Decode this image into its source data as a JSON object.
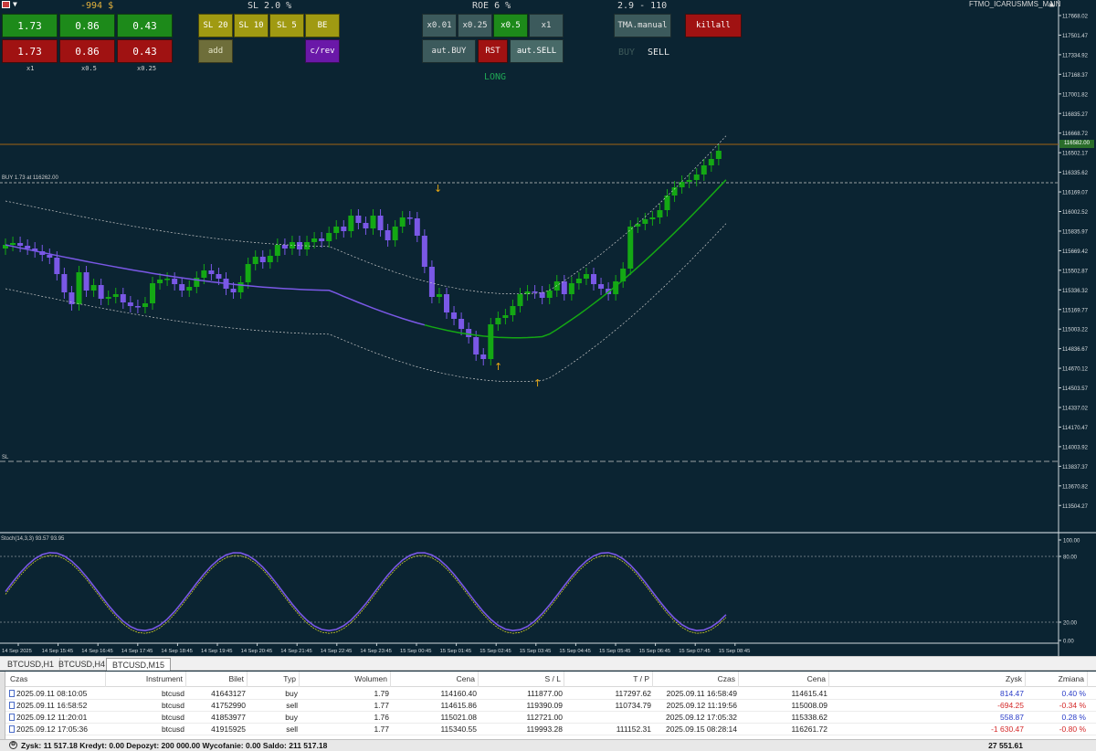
{
  "header": {
    "pnl": "-994 $",
    "sl_title": "SL 2.0 %",
    "roe_title": "ROE 6 %",
    "range_title": "2.9 - 110",
    "symbol_label": "FTMO_ICARUSMMS_MAIN"
  },
  "lot_buttons": {
    "buy_row": [
      "1.73",
      "0.86",
      "0.43"
    ],
    "sell_row": [
      "1.73",
      "0.86",
      "0.43"
    ],
    "captions": [
      "x1",
      "x0.5",
      "x0.25"
    ]
  },
  "sl_buttons": [
    "SL 20",
    "SL 10",
    "SL 5",
    "BE"
  ],
  "add_label": "add",
  "crev_label": "c/rev",
  "mult_buttons": [
    "x0.01",
    "x0.25",
    "x0.5",
    "x1"
  ],
  "auto_buttons": {
    "buy": "aut.BUY",
    "rst": "RST",
    "sell": "aut.SELL"
  },
  "tma_label": "TMA.manual",
  "killall_label": "killall",
  "buy_sell": {
    "buy": "BUY",
    "sell": "SELL"
  },
  "signal_label": "LONG",
  "chart_labels": {
    "buy_line": "BUY 1.73 at 116262.00",
    "sl_line": "SL",
    "price_current": "116582.00",
    "stoch": "Stoch(14,3,3) 93.57 93.95"
  },
  "colors": {
    "bg": "#0b2432",
    "bull": "#14a814",
    "bear": "#7a58e6",
    "signal": "#e8a814",
    "price_line": "#a06414"
  },
  "price_axis": [
    "117668.02",
    "117501.47",
    "117334.92",
    "117168.37",
    "117001.82",
    "116835.27",
    "116668.72",
    "116502.17",
    "116335.62",
    "116169.07",
    "116002.52",
    "115835.97",
    "115669.42",
    "115502.87",
    "115336.32",
    "115169.77",
    "115003.22",
    "114836.67",
    "114670.12",
    "114503.57",
    "114337.02",
    "114170.47",
    "114003.92",
    "113837.37",
    "113670.82",
    "113504.27"
  ],
  "stoch_axis": [
    "100.00",
    "80.00",
    "20.00",
    "0.00"
  ],
  "time_axis": [
    "14 Sep 2025",
    "14 Sep 15:45",
    "14 Sep 16:45",
    "14 Sep 17:45",
    "14 Sep 18:45",
    "14 Sep 19:45",
    "14 Sep 20:45",
    "14 Sep 21:45",
    "14 Sep 22:45",
    "14 Sep 23:45",
    "15 Sep 00:45",
    "15 Sep 01:45",
    "15 Sep 02:45",
    "15 Sep 03:45",
    "15 Sep 04:45",
    "15 Sep 05:45",
    "15 Sep 06:45",
    "15 Sep 07:45",
    "15 Sep 08:45"
  ],
  "tabs": [
    "BTCUSD,H1",
    "BTCUSD,H4",
    "BTCUSD,M15"
  ],
  "table": {
    "headers": [
      "Czas",
      "Instrument",
      "Bilet",
      "Typ",
      "Wolumen",
      "Cena",
      "S / L",
      "T / P",
      "Czas",
      "Cena",
      "Zysk",
      "Zmiana"
    ],
    "rows": [
      [
        "2025.09.11 08:10:05",
        "btcusd",
        "41643127",
        "buy",
        "1.79",
        "114160.40",
        "111877.00",
        "117297.62",
        "2025.09.11 16:58:49",
        "114615.41",
        "814.47",
        "0.40 %"
      ],
      [
        "2025.09.11 16:58:52",
        "btcusd",
        "41752990",
        "sell",
        "1.77",
        "114615.86",
        "119390.09",
        "110734.79",
        "2025.09.12 11:19:56",
        "115008.09",
        "-694.25",
        "-0.34 %"
      ],
      [
        "2025.09.12 11:20:01",
        "btcusd",
        "41853977",
        "buy",
        "1.76",
        "115021.08",
        "112721.00",
        "",
        "2025.09.12 17:05:32",
        "115338.62",
        "558.87",
        "0.28 %"
      ],
      [
        "2025.09.12 17:05:36",
        "btcusd",
        "41915925",
        "sell",
        "1.77",
        "115340.55",
        "119993.28",
        "111152.31",
        "2025.09.15 08:28:14",
        "116261.72",
        "-1 630.47",
        "-0.80 %"
      ]
    ]
  },
  "status": {
    "summary": "Zysk: 11 517.18  Kredyt: 0.00  Depozyt: 200 000.00  Wycofanie: 0.00  Saldo: 211 517.18",
    "total": "27 551.61"
  }
}
